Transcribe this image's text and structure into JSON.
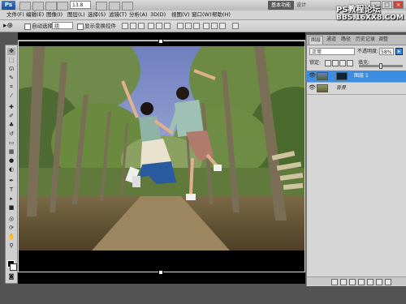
{
  "titlebar": {
    "zoom": "13.8",
    "workspace": "基本功能",
    "design": "设计",
    "minimize": "–",
    "maximize": "□",
    "close": "×",
    "watermark_line1": "PS教程论坛",
    "watermark_line2": "BBS.16XX8.COM"
  },
  "menu": [
    "文件(F)",
    "编辑(E)",
    "图像(I)",
    "图层(L)",
    "选择(S)",
    "滤镜(T)",
    "分析(A)",
    "3D(D)",
    "视图(V)",
    "窗口(W)",
    "帮助(H)"
  ],
  "options": {
    "auto_select": "自动选择:",
    "auto_select_value": "组",
    "show_transform": "显示变换控件"
  },
  "layers_panel": {
    "tabs": [
      "图层",
      "通道",
      "路径",
      "历史记录",
      "调整"
    ],
    "blend_mode": "正常",
    "opacity_label": "不透明度:",
    "opacity_value": "58%",
    "lock_label": "锁定:",
    "fill_label": "填充:",
    "fill_level": 0.5,
    "layers": [
      {
        "name": "图层 1",
        "selected": true
      },
      {
        "name": "背景",
        "selected": false
      }
    ]
  },
  "colors": {
    "accent": "#3d8de0",
    "foreground": "#000000",
    "background": "#ffffff"
  }
}
